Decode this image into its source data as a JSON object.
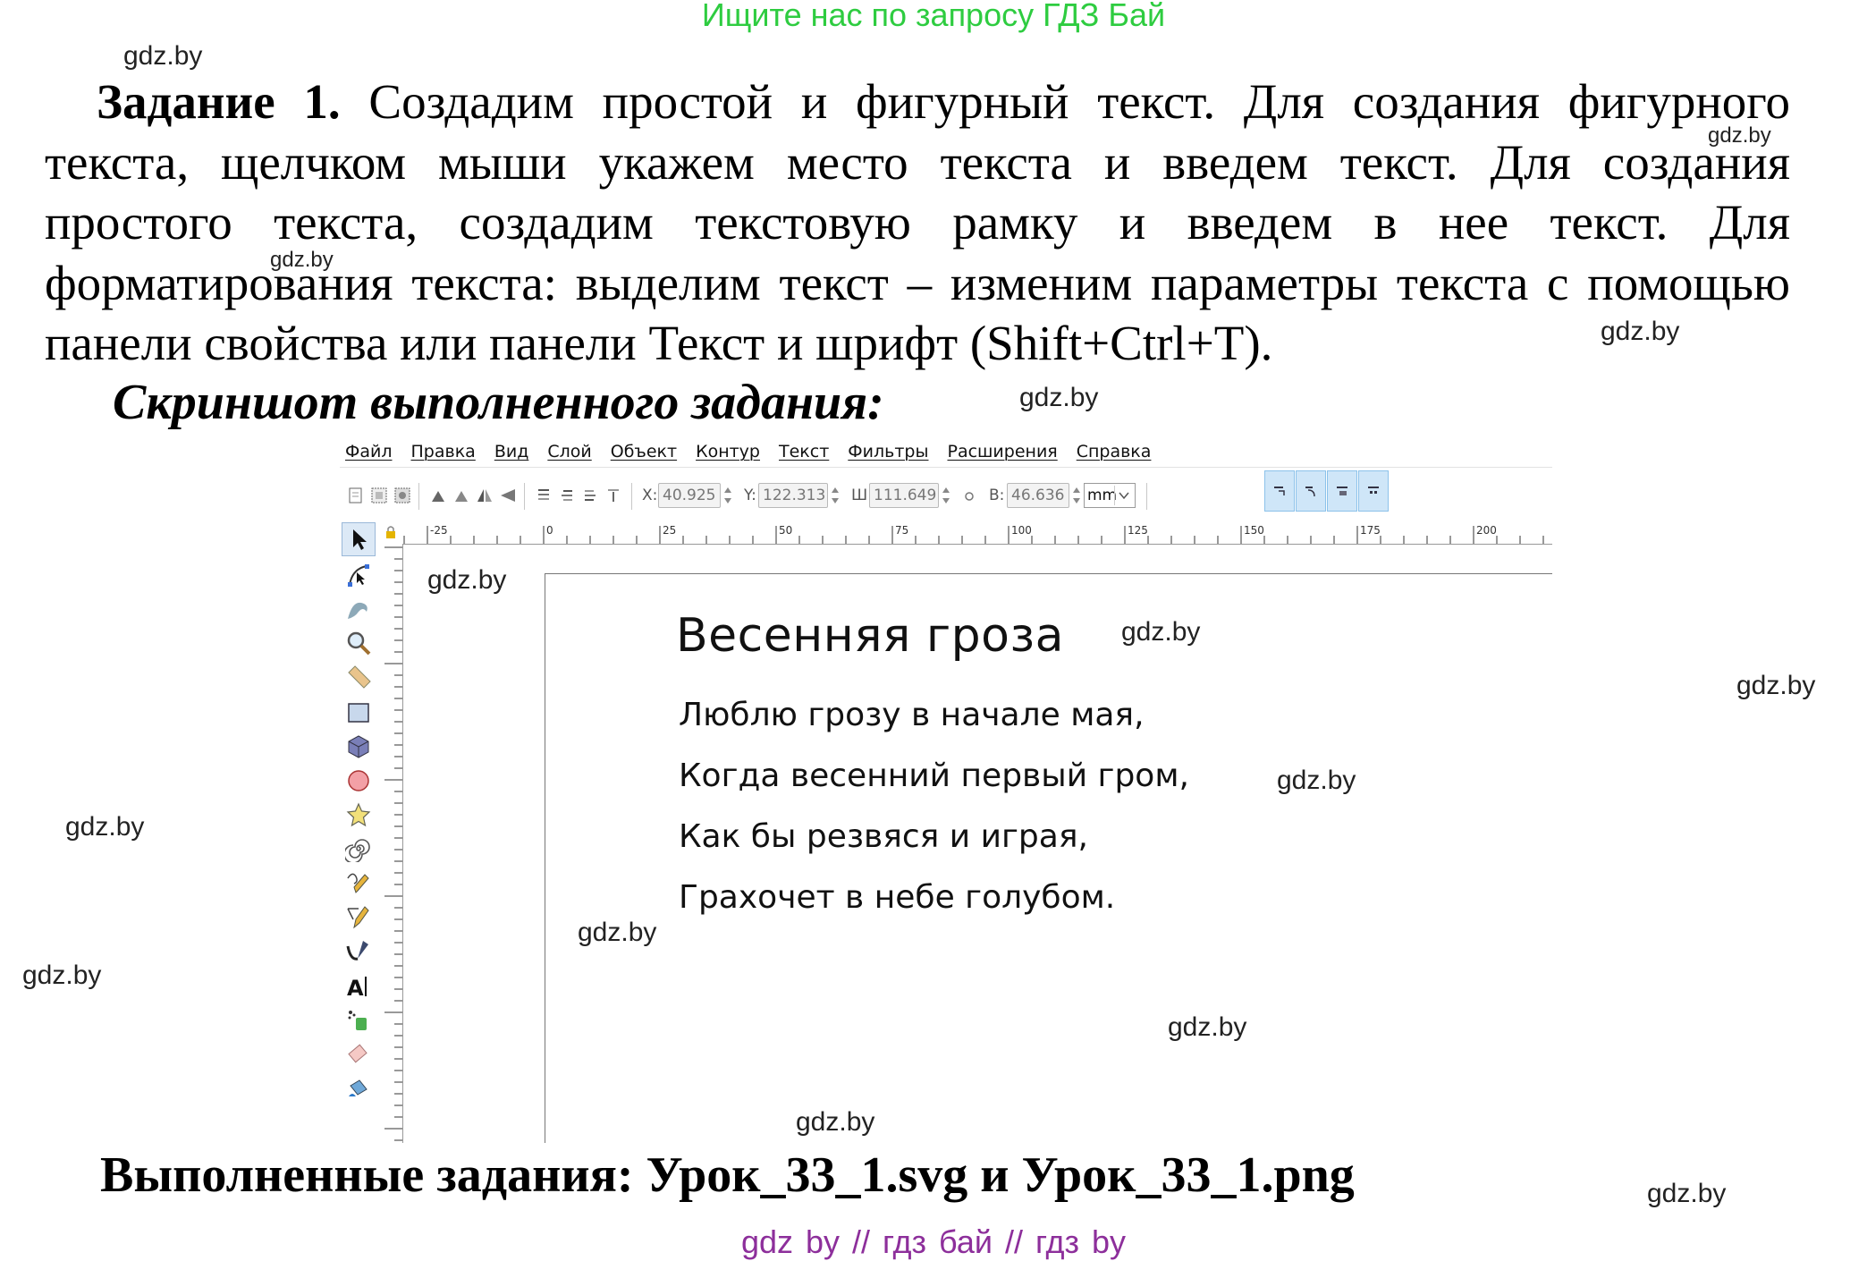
{
  "banner": "Ищите нас по запросу ГДЗ Бай",
  "watermark": "gdz.by",
  "task": {
    "title": "Задание 1.",
    "body": "Создадим простой и фигурный текст. Для создания фигурного текста, щелчком мыши укажем место текста и введем текст. Для создания простого текста, создадим текстовую рамку и введем в нее текст. Для форматирования текста: выделим текст – изменим параметры текста с помощью панели свойства или панели Текст и шрифт (Shift+Ctrl+T)."
  },
  "screenshot_heading": "Скриншот выполненного задания:",
  "inkscape": {
    "menu": [
      "Файл",
      "Правка",
      "Вид",
      "Слой",
      "Объект",
      "Контур",
      "Текст",
      "Фильтры",
      "Расширения",
      "Справка"
    ],
    "toolbar": {
      "x_label": "X:",
      "x_value": "40.925",
      "y_label": "Y:",
      "y_value": "122.313",
      "w_label": "Ш:",
      "w_value": "111.649",
      "h_label": "В:",
      "h_value": "46.636",
      "unit": "mm"
    },
    "ruler_top_ticks": [
      "-25",
      "0",
      "25",
      "50",
      "75",
      "100",
      "125",
      "150",
      "175",
      "200"
    ],
    "canvas_title": "Весенняя гроза",
    "poem": [
      "Люблю грозу в начале мая,",
      "Когда весенний первый гром,",
      "Как бы резвяся и играя,",
      "Грахочет в небе голубом."
    ]
  },
  "done_line": "Выполненные задания: Урок_33_1.svg и Урок_33_1.png",
  "footer": "gdz by  //  гдз бай  //  гдз by",
  "colors": {
    "banner": "#2ecc40",
    "footer": "#8d2f9b",
    "snap_active": "#cfe6f8"
  }
}
